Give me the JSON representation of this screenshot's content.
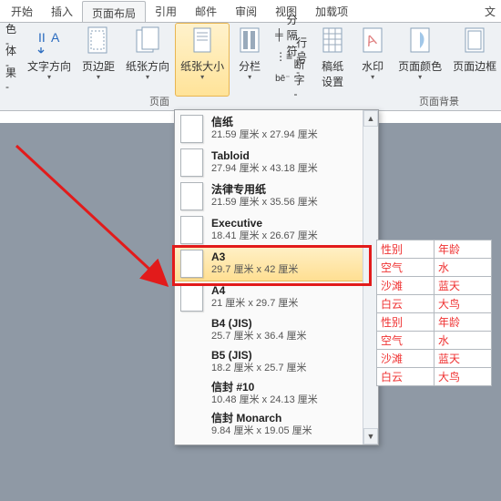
{
  "title_tail": "文",
  "tabs": [
    "开始",
    "插入",
    "页面布局",
    "引用",
    "邮件",
    "审阅",
    "视图",
    "加载项"
  ],
  "active_tab_index": 2,
  "ribbon": {
    "left_partial": {
      "line1": "色 -",
      "line2": "体 -",
      "line3": "果 -"
    },
    "groups": {
      "setup": "页面",
      "bg": "页面背景"
    },
    "buttons": {
      "text_direction": "文字方向",
      "margins": "页边距",
      "orientation": "纸张方向",
      "size": "纸张大小",
      "columns": "分栏",
      "breaks": "分隔符 -",
      "line_numbers": "行号 -",
      "hyphenation": "断字 -",
      "paper_settings": "稿纸\n设置",
      "watermark": "水印",
      "page_color": "页面颜色",
      "page_borders": "页面边框"
    }
  },
  "dropdown": {
    "items": [
      {
        "name": "信纸",
        "size": "21.59 厘米 x 27.94 厘米",
        "page": true
      },
      {
        "name": "Tabloid",
        "size": "27.94 厘米 x 43.18 厘米",
        "page": true
      },
      {
        "name": "法律专用纸",
        "size": "21.59 厘米 x 35.56 厘米",
        "page": true
      },
      {
        "name": "Executive",
        "size": "18.41 厘米 x 26.67 厘米",
        "page": true
      },
      {
        "name": "A3",
        "size": "29.7 厘米 x 42 厘米",
        "page": true,
        "highlight": true
      },
      {
        "name": "A4",
        "size": "21 厘米 x 29.7 厘米",
        "page": true
      },
      {
        "name": "B4 (JIS)",
        "size": "25.7 厘米 x 36.4 厘米",
        "page": false
      },
      {
        "name": "B5 (JIS)",
        "size": "18.2 厘米 x 25.7 厘米",
        "page": false
      },
      {
        "name": "信封 #10",
        "size": "10.48 厘米 x 24.13 厘米",
        "page": false
      },
      {
        "name": "信封 Monarch",
        "size": "9.84 厘米 x 19.05 厘米",
        "page": false
      }
    ]
  },
  "table_cells": [
    [
      "性别",
      "年龄"
    ],
    [
      "空气",
      "水"
    ],
    [
      "沙滩",
      "蓝天"
    ],
    [
      "白云",
      "大鸟"
    ],
    [
      "性别",
      "年龄"
    ],
    [
      "空气",
      "水"
    ],
    [
      "沙滩",
      "蓝天"
    ],
    [
      "白云",
      "大鸟"
    ]
  ]
}
